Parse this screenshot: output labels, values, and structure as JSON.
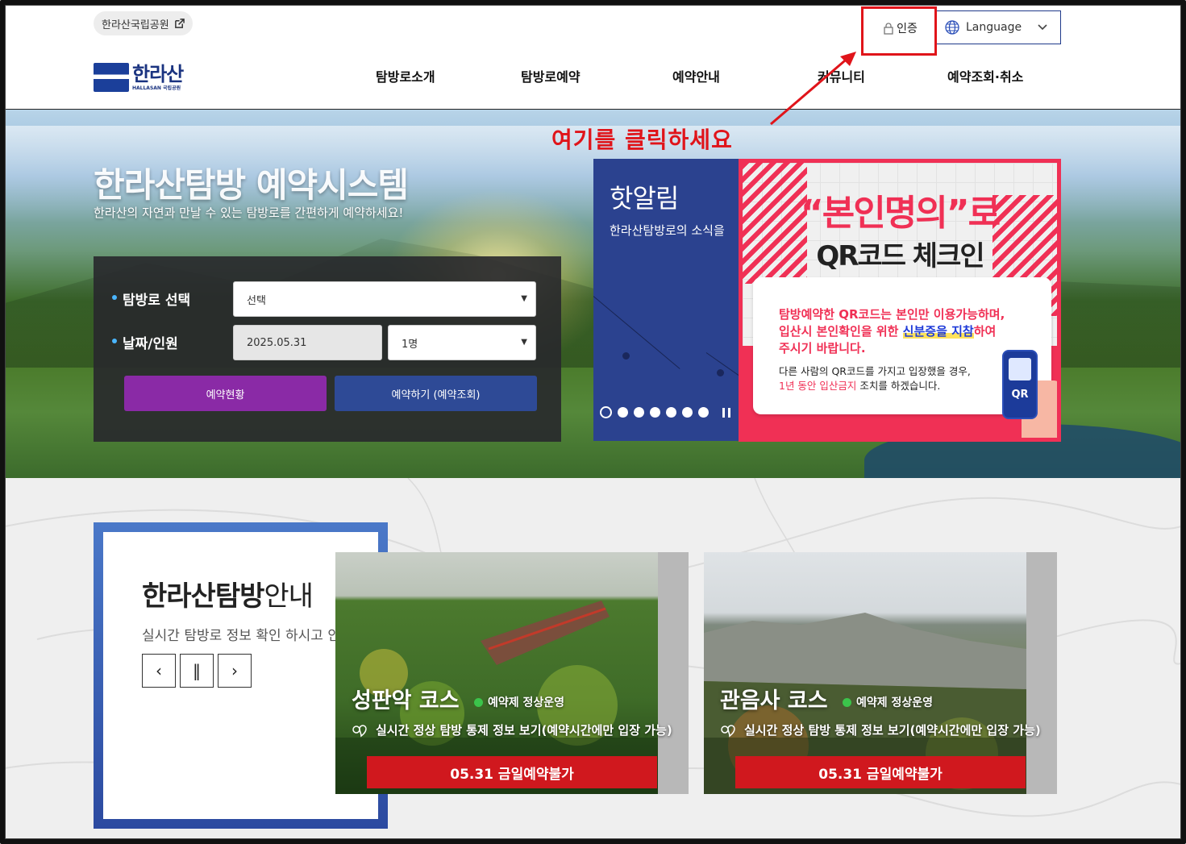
{
  "header": {
    "park_link": "한라산국립공원",
    "auth_label": "인증",
    "language_label": "Language",
    "logo_text": "한라산",
    "logo_sub": "HALLASAN 국립공원",
    "nav": [
      "탐방로소개",
      "탐방로예약",
      "예약안내",
      "커뮤니티",
      "예약조회·취소"
    ]
  },
  "annotation": {
    "text": "여기를 클릭하세요",
    "color": "#e0141a"
  },
  "hero": {
    "title": "한라산탐방 예약시스템",
    "subtitle": "한라산의 자연과 만날 수 있는 탐방로를 간편하게 예약하세요!"
  },
  "booking": {
    "trail_label": "탐방로 선택",
    "trail_value": "선택",
    "date_label": "날짜/인원",
    "date_value": "2025.05.31",
    "people_value": "1명",
    "status_button": "예약현황",
    "reserve_button": "예약하기 (예약조회)",
    "status_color": "#8a2aa6",
    "reserve_color": "#2e4a96"
  },
  "notice": {
    "title": "핫알림",
    "text": "한라산탐방로의 소식을"
  },
  "qr_banner": {
    "head1": "“본인명의”로",
    "head2": "QR코드 체크인",
    "line1a": "탐방예약한 QR코드는 본인만 이용가능하며,",
    "line1b": "입산시 본인확인을 위한 ",
    "line1b_highlight": "신분증을 지참",
    "line1b_end": "하여",
    "line1c": "주시기 바랍니다.",
    "line2a": "다른 사람의 QR코드를 가지고 입장했을 경우,",
    "line2b_red": "1년 동안 입산금지",
    "line2b_end": " 조치를 하겠습니다.",
    "phone_label": "QR",
    "accent": "#f03055"
  },
  "guide": {
    "title_bold": "한라산탐방",
    "title_rest": "안내",
    "subtitle": "실시간 탐방로 정보 확인 하시고 안",
    "prev": "‹",
    "pause": "‖",
    "next": "›"
  },
  "courses": [
    {
      "name": "성판악 코스",
      "status": "예약제 정상운영",
      "link": "실시간 정상 탐방 통제 정보 보기(예약시간에만 입장 가능)",
      "button": "05.31 금일예약불가"
    },
    {
      "name": "관음사 코스",
      "status": "예약제 정상운영",
      "link": "실시간 정상 탐방 통제 정보 보기(예약시간에만 입장 가능)",
      "button": "05.31 금일예약불가"
    }
  ]
}
